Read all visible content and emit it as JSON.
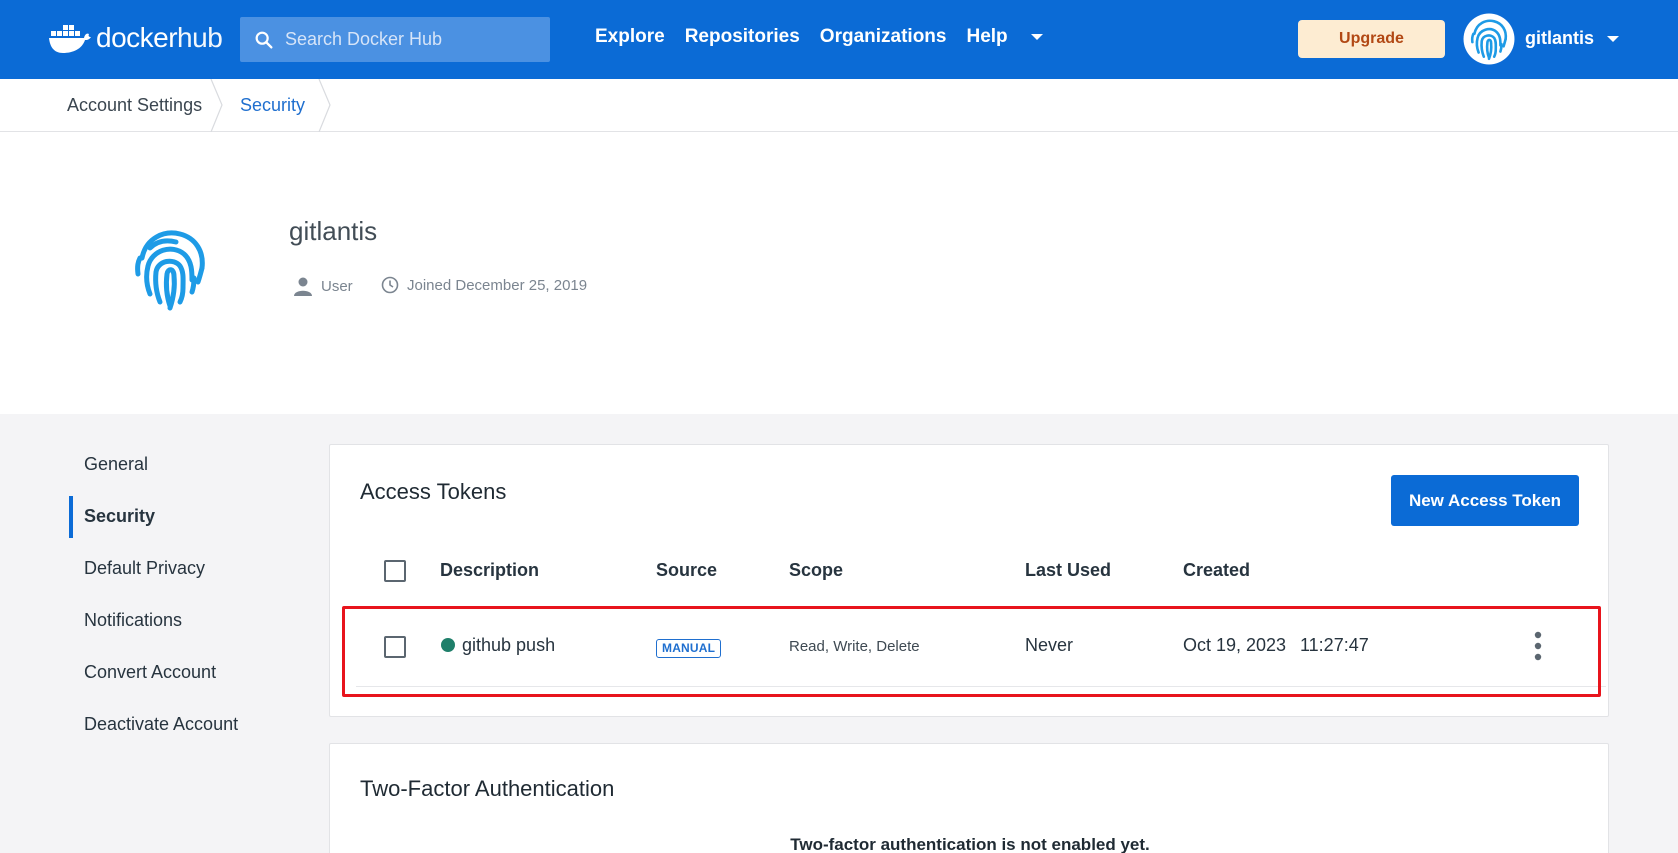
{
  "nav": {
    "logo_text_bold": "docker",
    "logo_text_light": "hub",
    "search_placeholder": "Search Docker Hub",
    "links": [
      "Explore",
      "Repositories",
      "Organizations",
      "Help"
    ],
    "upgrade_label": "Upgrade",
    "username": "gitlantis"
  },
  "breadcrumb": [
    "Account Settings",
    "Security"
  ],
  "profile": {
    "name": "gitlantis",
    "role": "User",
    "joined": "Joined December 25, 2019"
  },
  "sidebar": {
    "items": [
      "General",
      "Security",
      "Default Privacy",
      "Notifications",
      "Convert Account",
      "Deactivate Account"
    ],
    "active": "Security"
  },
  "access_tokens": {
    "title": "Access Tokens",
    "new_button": "New Access Token",
    "columns": [
      "Description",
      "Source",
      "Scope",
      "Last Used",
      "Created"
    ],
    "rows": [
      {
        "description": "github push",
        "source": "MANUAL",
        "scope": "Read, Write, Delete",
        "last_used": "Never",
        "created_date": "Oct 19, 2023",
        "created_time": "11:27:47",
        "status_color": "#1f7f6a"
      }
    ]
  },
  "two_factor": {
    "title": "Two-Factor Authentication",
    "message": "Two-factor authentication is not enabled yet."
  },
  "colors": {
    "primary": "#0b6bd6",
    "highlight": "#e8141c",
    "upgrade_bg": "#fdecd2",
    "upgrade_text": "#b24814"
  }
}
